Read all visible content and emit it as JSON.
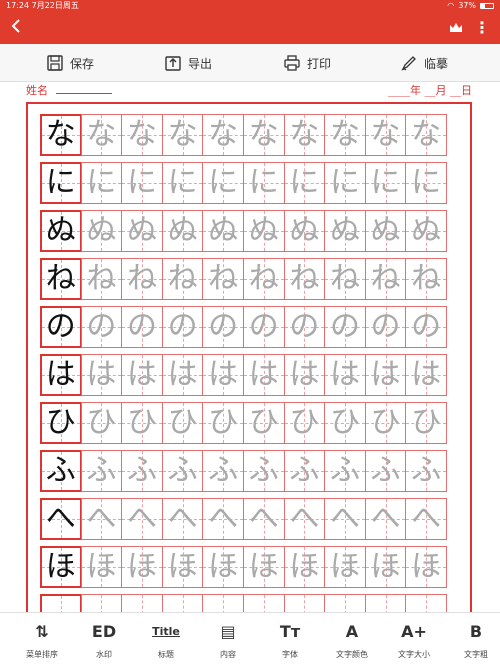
{
  "status": {
    "time": "17:24",
    "date": "7月22日周五",
    "battery": "37%"
  },
  "toolbar": {
    "save": "保存",
    "export": "导出",
    "print": "打印",
    "trace": "临摹"
  },
  "fields": {
    "name_label": "姓名",
    "date_text": "____年 __月 __日"
  },
  "practice": {
    "characters": [
      "な",
      "に",
      "ぬ",
      "ね",
      "の",
      "は",
      "ひ",
      "ふ",
      "へ",
      "ほ"
    ]
  },
  "tabs": [
    {
      "label": "菜单排序",
      "icon": "sort-icon",
      "glyph": "⇅"
    },
    {
      "label": "水印",
      "icon": "watermark-icon",
      "glyph": "ED"
    },
    {
      "label": "标题",
      "icon": "title-icon",
      "glyph": "Title"
    },
    {
      "label": "内容",
      "icon": "content-icon",
      "glyph": "▤"
    },
    {
      "label": "字体",
      "icon": "font-icon",
      "glyph": "Tт"
    },
    {
      "label": "文字颜色",
      "icon": "text-color-icon",
      "glyph": "A"
    },
    {
      "label": "文字大小",
      "icon": "text-size-icon",
      "glyph": "A+"
    },
    {
      "label": "文字粗",
      "icon": "bold-icon",
      "glyph": "B"
    }
  ]
}
